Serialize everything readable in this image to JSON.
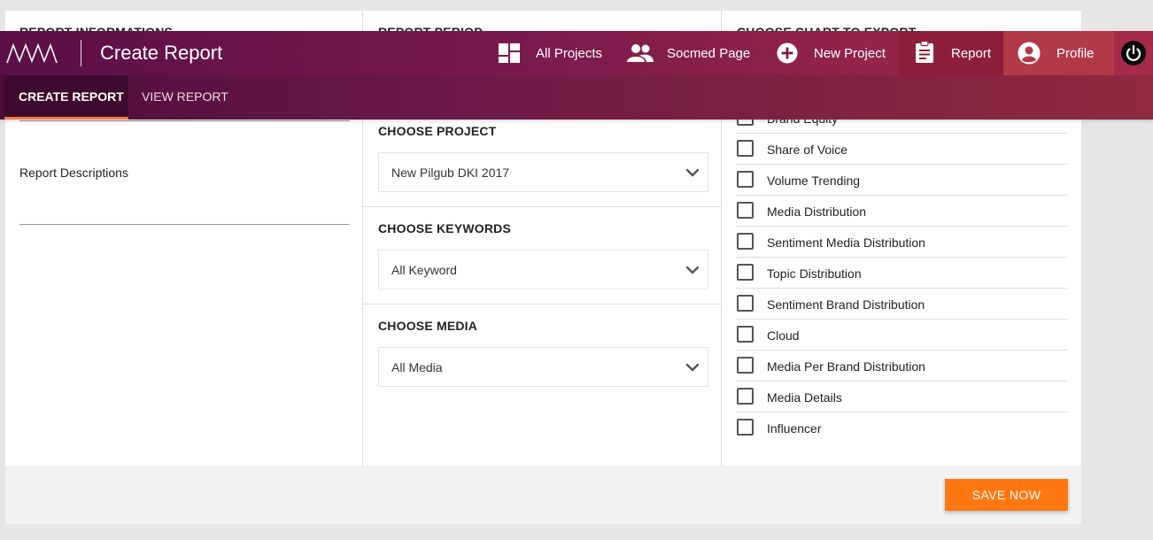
{
  "header": {
    "app_title": "Create Report",
    "nav": [
      {
        "label": "All Projects",
        "icon": "dashboard-icon"
      },
      {
        "label": "Socmed Page",
        "icon": "people-icon"
      },
      {
        "label": "New Project",
        "icon": "add-circle-icon"
      },
      {
        "label": "Report",
        "icon": "clipboard-icon"
      },
      {
        "label": "Profile",
        "icon": "account-icon"
      }
    ],
    "power_icon": "power-icon"
  },
  "subnav": {
    "tabs": [
      {
        "label": "CREATE REPORT"
      },
      {
        "label": "VIEW REPORT"
      }
    ]
  },
  "report_info": {
    "heading": "REPORT INFORMATIONS",
    "description_label": "Report Descriptions"
  },
  "report_period": {
    "heading": "REPORT PERIOD"
  },
  "project": {
    "heading": "CHOOSE PROJECT",
    "selected": "New Pilgub DKI 2017"
  },
  "keywords": {
    "heading": "CHOOSE KEYWORDS",
    "selected": "All Keyword"
  },
  "media": {
    "heading": "CHOOSE MEDIA",
    "selected": "All Media"
  },
  "charts": {
    "heading": "CHOOSE CHART TO EXPORT",
    "items": [
      {
        "label": "Brand Equity"
      },
      {
        "label": "Share of Voice"
      },
      {
        "label": "Volume Trending"
      },
      {
        "label": "Media Distribution"
      },
      {
        "label": "Sentiment Media Distribution"
      },
      {
        "label": "Topic Distribution"
      },
      {
        "label": "Sentiment Brand Distribution"
      },
      {
        "label": "Cloud"
      },
      {
        "label": "Media Per Brand Distribution"
      },
      {
        "label": "Media Details"
      },
      {
        "label": "Influencer"
      }
    ]
  },
  "footer": {
    "save_label": "SAVE NOW"
  },
  "colors": {
    "accent": "#ff7711",
    "header_start": "#5b0f46",
    "header_end": "#a82c4a"
  }
}
